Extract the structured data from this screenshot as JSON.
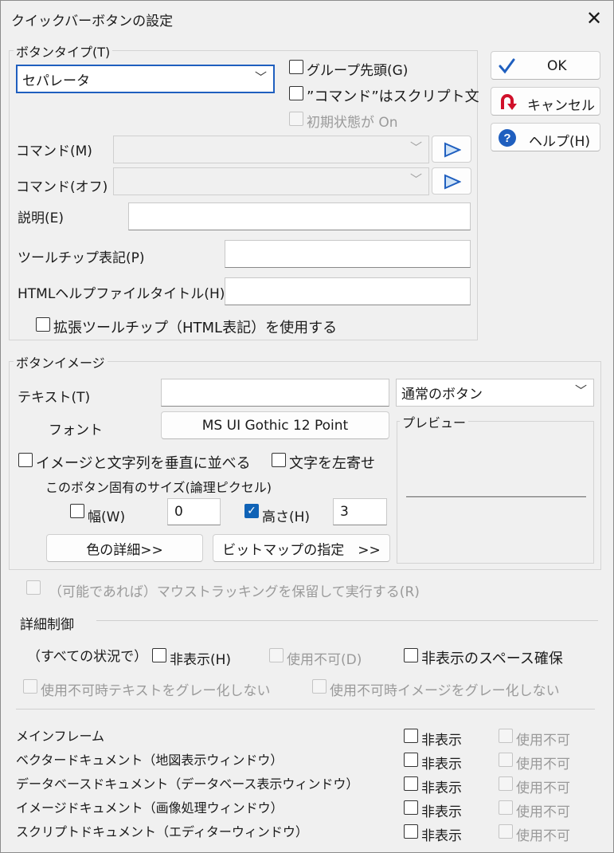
{
  "window": {
    "title": "クイックバーボタンの設定",
    "close": "✕"
  },
  "group_button_type": {
    "label": "ボタンタイプ(T)",
    "type_value": "セパレータ",
    "group_head": "グループ先頭(G)",
    "command_is_script": "”コマンド”はスクリプト文",
    "initial_on": "初期状態が On",
    "command_label": "コマンド(M)",
    "command_off_label": "コマンド(オフ)",
    "desc_label": "説明(E)",
    "tooltip_label": "ツールチップ表記(P)",
    "html_help_label": "HTMLヘルプファイルタイトル(H)",
    "ext_tooltip": "拡張ツールチップ（HTML表記）を使用する"
  },
  "buttons": {
    "ok": "OK",
    "cancel": "キャンセル",
    "help": "ヘルプ(H)"
  },
  "group_image": {
    "label": "ボタンイメージ",
    "text_label": "テキスト(T)",
    "style_value": "通常のボタン",
    "font_label": "フォント",
    "font_button": "MS UI Gothic 12 Point",
    "preview_label": "プレビュー",
    "vertical": "イメージと文字列を垂直に並べる",
    "left_align": "文字を左寄せ",
    "size_caption": "このボタン固有のサイズ(論理ピクセル)",
    "width_label": "幅(W)",
    "width_value": "0",
    "height_label": "高さ(H)",
    "height_value": "3",
    "color_button": "色の詳細>>",
    "bitmap_button": "ビットマップの指定　>>"
  },
  "mouse_tracking": "（可能であれば）マウストラッキングを保留して実行する(R)",
  "detail": {
    "heading": "詳細制御",
    "all_situations": "（すべての状況で）",
    "hide": "非表示(H)",
    "disable": "使用不可(D)",
    "reserve_space": "非表示のスペース確保",
    "no_gray_text": "使用不可時テキストをグレー化しない",
    "no_gray_image": "使用不可時イメージをグレー化しない",
    "rows": [
      {
        "name": "メインフレーム",
        "hide": "非表示",
        "disable": "使用不可"
      },
      {
        "name": "ベクタードキュメント（地図表示ウィンドウ）",
        "hide": "非表示",
        "disable": "使用不可"
      },
      {
        "name": "データベースドキュメント（データベース表示ウィンドウ）",
        "hide": "非表示",
        "disable": "使用不可"
      },
      {
        "name": "イメージドキュメント（画像処理ウィンドウ）",
        "hide": "非表示",
        "disable": "使用不可"
      },
      {
        "name": "スクリプトドキュメント（エディターウィンドウ）",
        "hide": "非表示",
        "disable": "使用不可"
      }
    ]
  },
  "colors": {
    "accent": "#0f62b6",
    "ok_check": "#1f5fbf",
    "cancel_icon": "#d0102a",
    "help_icon": "#1f5fbf"
  }
}
